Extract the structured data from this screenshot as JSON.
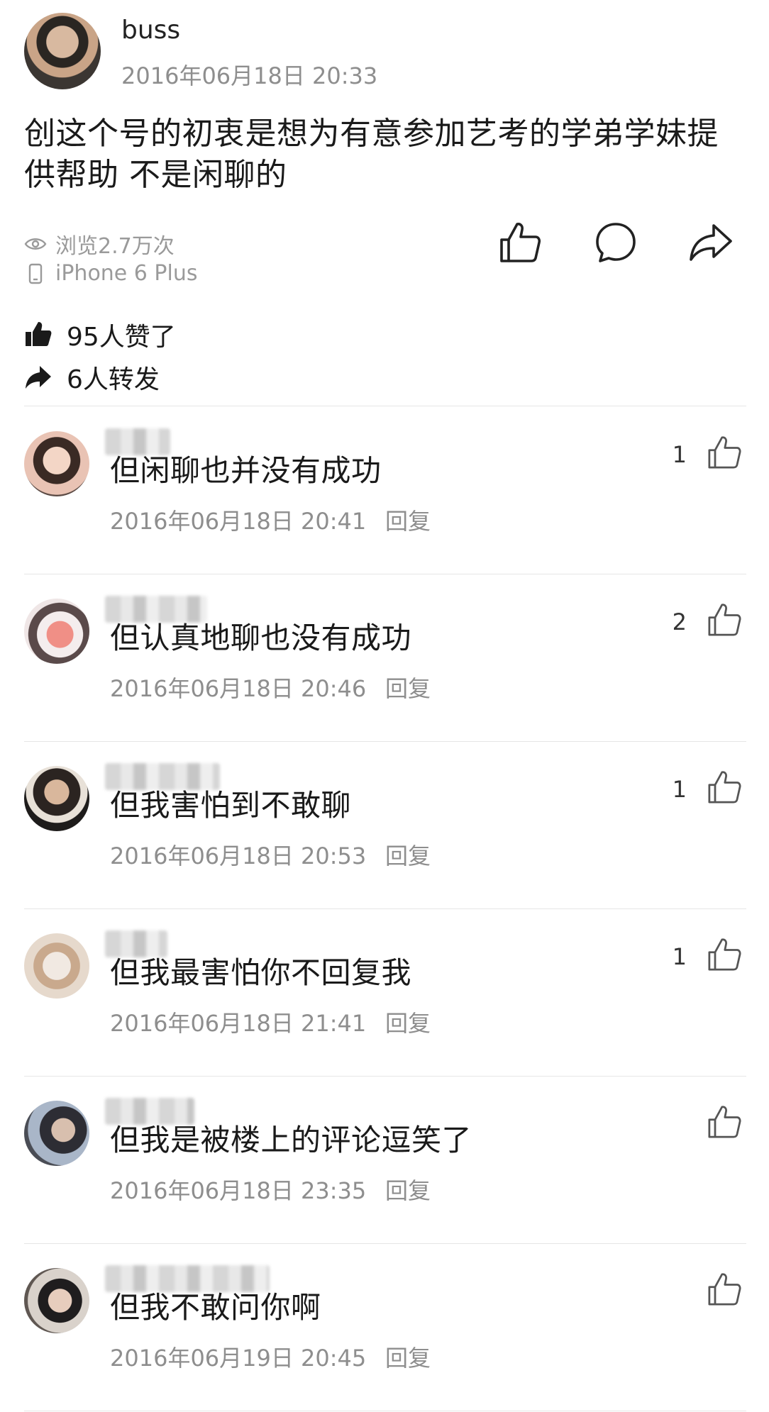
{
  "post": {
    "username": "buss",
    "timestamp": "2016年06月18日 20:33",
    "content": "创这个号的初衷是想为有意参加艺考的学弟学妹提供帮助 不是闲聊的",
    "views": "浏览2.7万次",
    "device": "iPhone 6 Plus",
    "likes_text": "95人赞了",
    "shares_text": "6人转发"
  },
  "icons": {
    "view": "eye-icon",
    "device": "phone-icon",
    "like": "thumbs-up-icon",
    "comment": "comment-bubble-icon",
    "share": "share-arrow-icon"
  },
  "comments": [
    {
      "text": "但闲聊也并没有成功",
      "time": "2016年06月18日 20:41",
      "reply": "回复",
      "likes": "1"
    },
    {
      "text": "但认真地聊也没有成功",
      "time": "2016年06月18日 20:46",
      "reply": "回复",
      "likes": "2"
    },
    {
      "text": "但我害怕到不敢聊",
      "time": "2016年06月18日 20:53",
      "reply": "回复",
      "likes": "1"
    },
    {
      "text": "但我最害怕你不回复我",
      "time": "2016年06月18日 21:41",
      "reply": "回复",
      "likes": "1"
    },
    {
      "text": "但我是被楼上的评论逗笑了",
      "time": "2016年06月18日 23:35",
      "reply": "回复",
      "likes": ""
    },
    {
      "text": "但我不敢问你啊",
      "time": "2016年06月19日 20:45",
      "reply": "回复",
      "likes": ""
    }
  ]
}
